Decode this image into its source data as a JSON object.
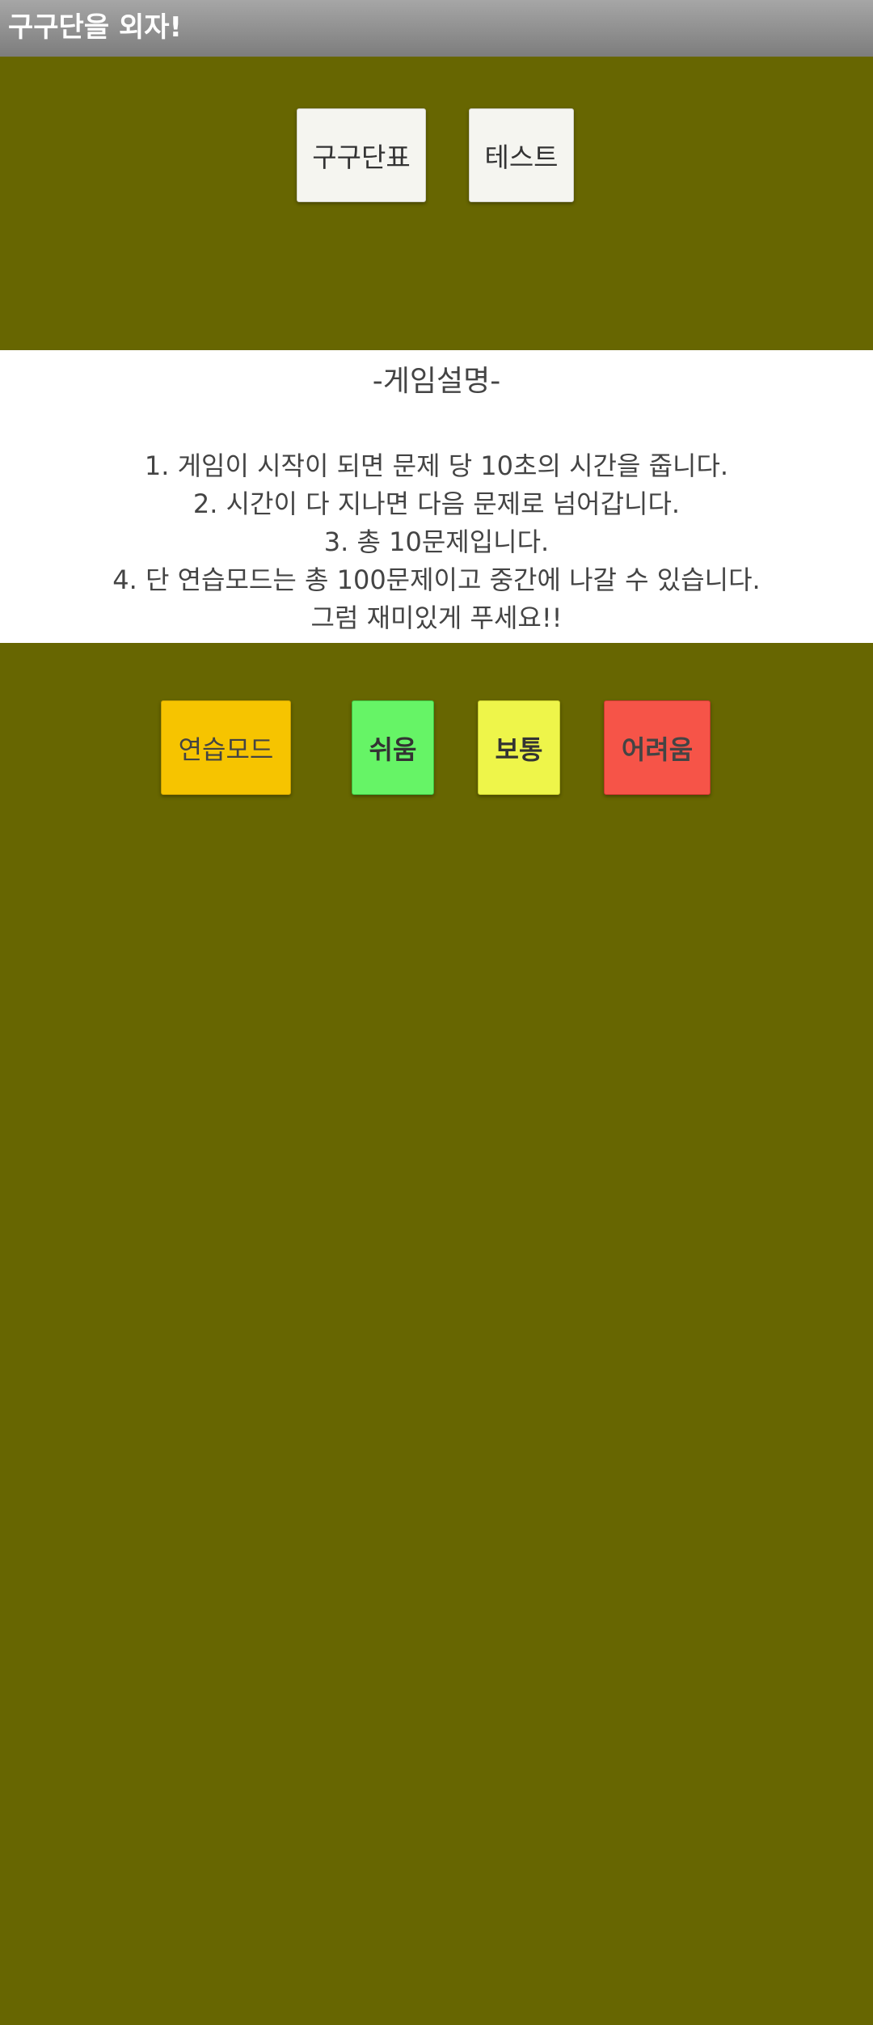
{
  "app_bar": {
    "title": "구구단을 외자!"
  },
  "top_buttons": {
    "table_label": "구구단표",
    "test_label": "테스트"
  },
  "description": {
    "title": "-게임설명-",
    "lines": [
      "1. 게임이 시작이 되면 문제 당 10초의 시간을 줍니다.",
      "2. 시간이 다 지나면 다음 문제로 넘어갑니다.",
      "3. 총 10문제입니다.",
      "4. 단 연습모드는 총 100문제이고 중간에 나갈 수 있습니다.",
      "그럼 재미있게 푸세요!!"
    ]
  },
  "mode_buttons": {
    "practice_label": "연습모드",
    "easy_label": "쉬움",
    "normal_label": "보통",
    "hard_label": "어려움"
  },
  "colors": {
    "background": "#676601",
    "practice": "#f6c400",
    "easy": "#66f466",
    "normal": "#eef54a",
    "hard": "#f65448"
  }
}
